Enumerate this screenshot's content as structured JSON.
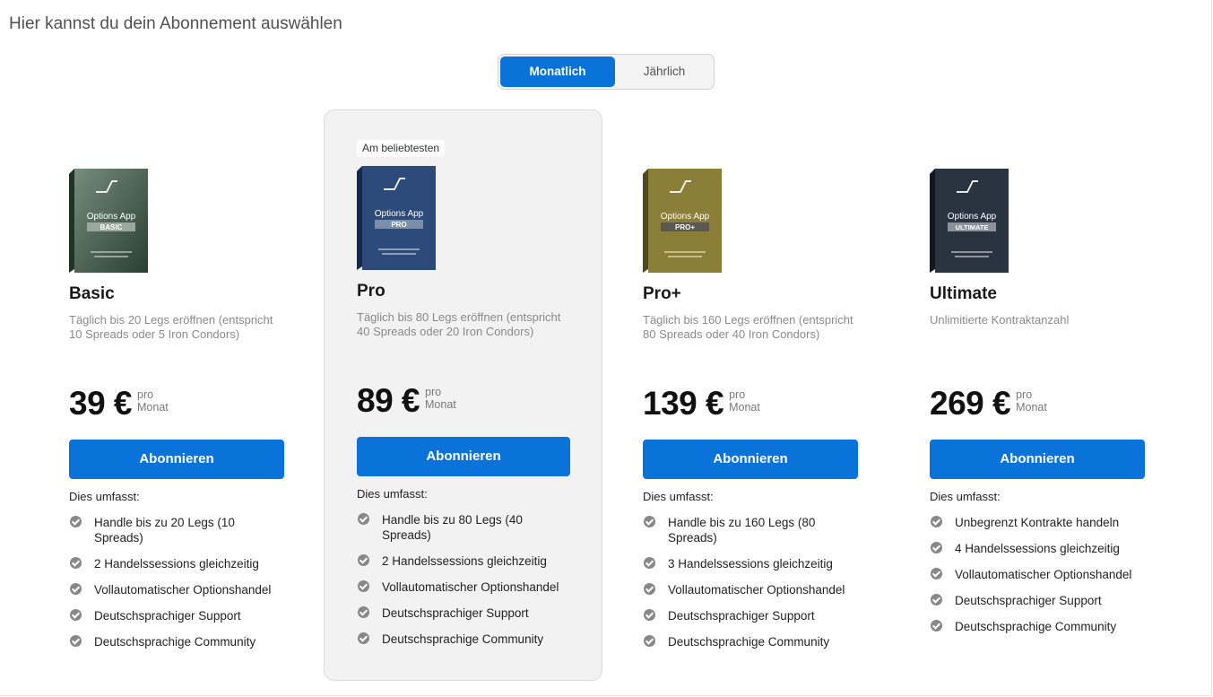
{
  "page": {
    "title": "Hier kannst du dein Abonnement auswählen"
  },
  "billing_toggle": {
    "monthly": "Monatlich",
    "yearly": "Jährlich",
    "selected": "Monatlich"
  },
  "badge": "Am beliebtesten",
  "includes_label": "Dies umfasst:",
  "colors": {
    "accent": "#0a73d9",
    "highlight_card": "#f2f2f2",
    "check_icon": "#888888"
  },
  "plans": [
    {
      "name": "Basic",
      "box_brand": "Options App",
      "box_tier": "BASIC",
      "box_color": "#3d5a45",
      "desc": "Täglich bis 20 Legs eröffnen (entspricht 10 Spreads oder 5 Iron Condors)",
      "price": "39 €",
      "unit_top": "pro",
      "unit_bottom": "Monat",
      "button": "Abonnieren",
      "features": [
        "Handle bis zu 20 Legs (10 Spreads)",
        "2 Handelssessions gleichzeitig",
        "Vollautomatischer Optionshandel",
        "Deutschsprachiger Support",
        "Deutschsprachige Community"
      ]
    },
    {
      "name": "Pro",
      "box_brand": "Options App",
      "box_tier": "PRO",
      "box_color": "#2c4a7a",
      "desc": "Täglich bis 80 Legs eröffnen (entspricht 40 Spreads oder 20 Iron Condors)",
      "price": "89 €",
      "unit_top": "pro",
      "unit_bottom": "Monat",
      "button": "Abonnieren",
      "features": [
        "Handle bis zu 80 Legs (40 Spreads)",
        "2 Handelssessions gleichzeitig",
        "Vollautomatischer Optionshandel",
        "Deutschsprachiger Support",
        "Deutschsprachige Community"
      ]
    },
    {
      "name": "Pro+",
      "box_brand": "Options App",
      "box_tier": "PRO+",
      "box_color": "#8a7e38",
      "desc": "Täglich bis 160 Legs eröffnen (entspricht 80 Spreads oder 40 Iron Condors)",
      "price": "139 €",
      "unit_top": "pro",
      "unit_bottom": "Monat",
      "button": "Abonnieren",
      "features": [
        "Handle bis zu 160 Legs (80 Spreads)",
        "3 Handelssessions gleichzeitig",
        "Vollautomatischer Optionshandel",
        "Deutschsprachiger Support",
        "Deutschsprachige Community"
      ]
    },
    {
      "name": "Ultimate",
      "box_brand": "Options App",
      "box_tier": "ULTIMATE",
      "box_color": "#2a3340",
      "desc": "Unlimitierte Kontraktanzahl",
      "price": "269 €",
      "unit_top": "pro",
      "unit_bottom": "Monat",
      "button": "Abonnieren",
      "features": [
        "Unbegrenzt Kontrakte handeln",
        "4 Handelssessions gleichzeitig",
        "Vollautomatischer Optionshandel",
        "Deutschsprachiger Support",
        "Deutschsprachige Community"
      ]
    }
  ]
}
